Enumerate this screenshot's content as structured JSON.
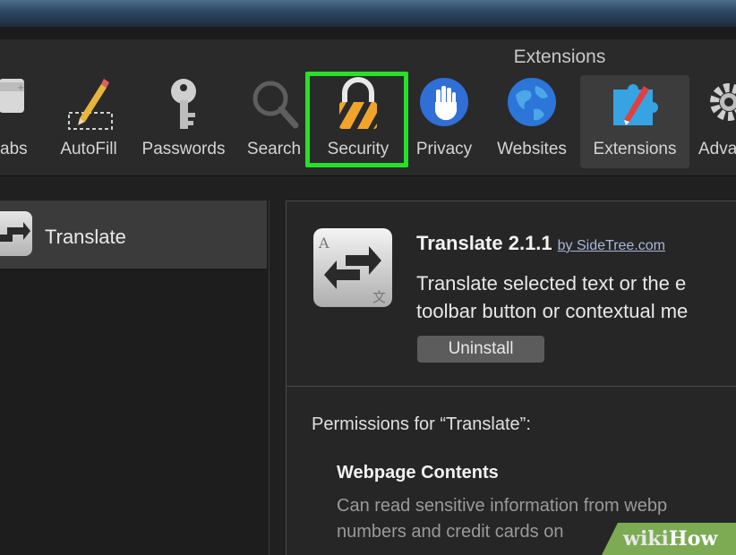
{
  "window": {
    "title": "Extensions"
  },
  "toolbar": {
    "items": [
      {
        "label": "abs",
        "icon": "tabs-icon"
      },
      {
        "label": "AutoFill",
        "icon": "pencil-icon"
      },
      {
        "label": "Passwords",
        "icon": "key-icon"
      },
      {
        "label": "Search",
        "icon": "magnifier-icon"
      },
      {
        "label": "Security",
        "icon": "lock-icon"
      },
      {
        "label": "Privacy",
        "icon": "hand-icon"
      },
      {
        "label": "Websites",
        "icon": "globe-icon"
      },
      {
        "label": "Extensions",
        "icon": "puzzle-icon"
      },
      {
        "label": "Adva",
        "icon": "gear-icon"
      }
    ],
    "highlight_color": "#27e027"
  },
  "sidebar": {
    "items": [
      {
        "label": "Translate",
        "selected": true
      }
    ]
  },
  "extension": {
    "name": "Translate 2.1.1",
    "by_label": "by SideTree.com",
    "description_line1": "Translate selected text or the e",
    "description_line2": "toolbar button or contextual me",
    "uninstall_label": "Uninstall",
    "permissions_title": "Permissions for “Translate”:",
    "permission_section": "Webpage Contents",
    "permission_desc_line1": "Can read sensitive information from webp",
    "permission_desc_line2": "numbers and credit cards on"
  },
  "watermark": {
    "part1": "wiki",
    "part2": "How"
  }
}
